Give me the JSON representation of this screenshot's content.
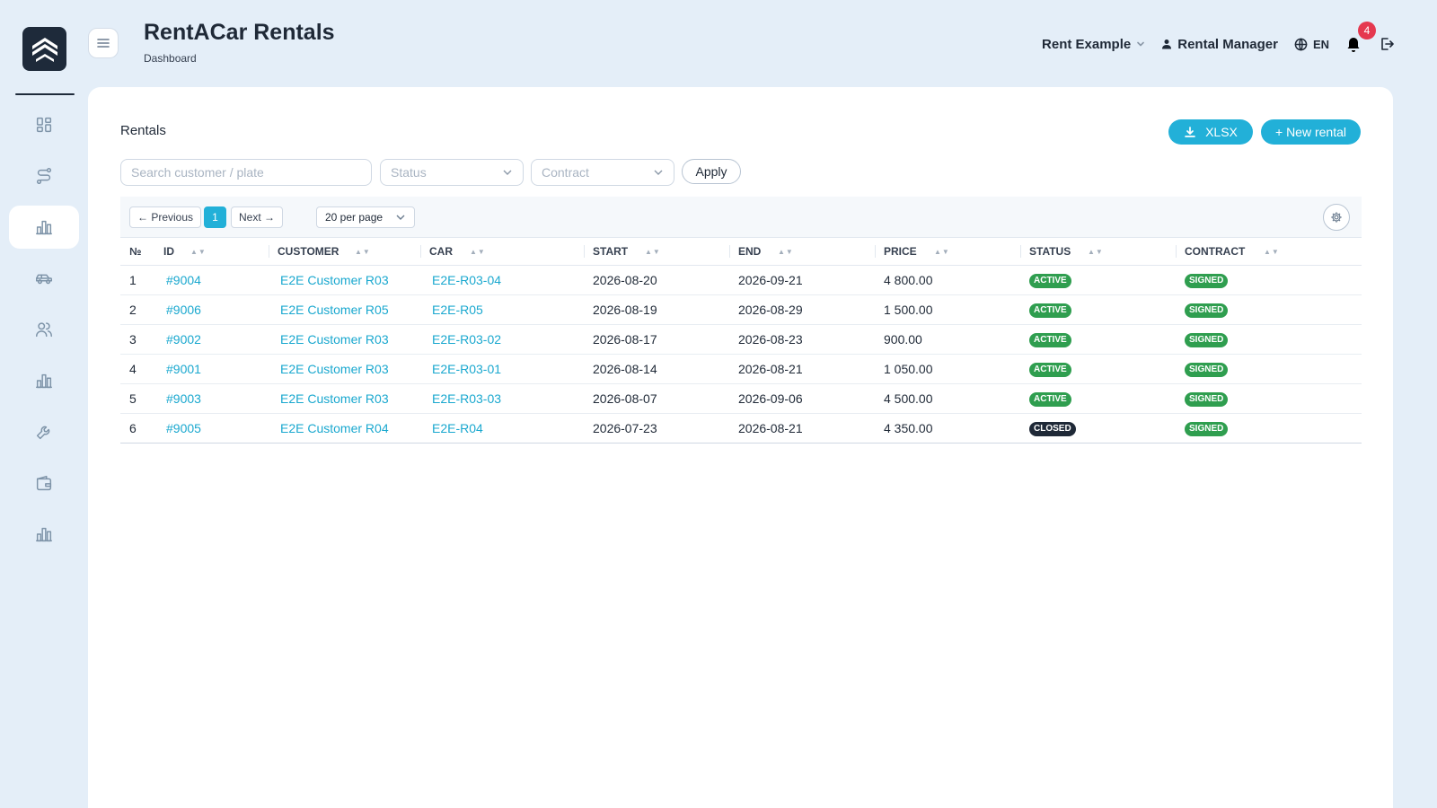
{
  "colors": {
    "accent": "#22b0d8",
    "link": "#1aa8cf",
    "active": "#2f9e4f",
    "closed": "#1f2937",
    "signed": "#2f9e4f",
    "badge": "#e5384f"
  },
  "app": {
    "title": "RentACar Rentals",
    "breadcrumb": "Dashboard"
  },
  "sidebar": {
    "items": [
      {
        "name": "dashboard-icon"
      },
      {
        "name": "routes-icon"
      },
      {
        "name": "bar-chart-icon",
        "active": true
      },
      {
        "name": "car-icon"
      },
      {
        "name": "users-icon"
      },
      {
        "name": "bar-chart-icon"
      },
      {
        "name": "wrench-icon"
      },
      {
        "name": "wallet-icon"
      },
      {
        "name": "bar-chart-icon"
      }
    ]
  },
  "topbar": {
    "company": "Rent Example",
    "user": "Rental Manager",
    "language": "EN",
    "notifications": "4"
  },
  "rentals": {
    "title": "Rentals",
    "export_label": "XLSX",
    "new_label": "+ New rental",
    "search_placeholder": "Search customer / plate",
    "status_placeholder": "Status",
    "contract_placeholder": "Contract",
    "apply_label": "Apply",
    "pagination": {
      "prev": "← Previous",
      "current": "1",
      "next": "Next →",
      "per_page": "20 per page"
    },
    "columns": [
      "№",
      "ID",
      "CUSTOMER",
      "CAR",
      "START",
      "END",
      "PRICE",
      "STATUS",
      "CONTRACT"
    ],
    "rows": [
      {
        "n": "1",
        "id": "#9004",
        "customer": "E2E Customer R03",
        "car": "E2E-R03-04",
        "start": "2026-08-20",
        "end": "2026-09-21",
        "price": "4 800.00",
        "status": "ACTIVE",
        "contract": "SIGNED"
      },
      {
        "n": "2",
        "id": "#9006",
        "customer": "E2E Customer R05",
        "car": "E2E-R05",
        "start": "2026-08-19",
        "end": "2026-08-29",
        "price": "1 500.00",
        "status": "ACTIVE",
        "contract": "SIGNED"
      },
      {
        "n": "3",
        "id": "#9002",
        "customer": "E2E Customer R03",
        "car": "E2E-R03-02",
        "start": "2026-08-17",
        "end": "2026-08-23",
        "price": "900.00",
        "status": "ACTIVE",
        "contract": "SIGNED"
      },
      {
        "n": "4",
        "id": "#9001",
        "customer": "E2E Customer R03",
        "car": "E2E-R03-01",
        "start": "2026-08-14",
        "end": "2026-08-21",
        "price": "1 050.00",
        "status": "ACTIVE",
        "contract": "SIGNED"
      },
      {
        "n": "5",
        "id": "#9003",
        "customer": "E2E Customer R03",
        "car": "E2E-R03-03",
        "start": "2026-08-07",
        "end": "2026-09-06",
        "price": "4 500.00",
        "status": "ACTIVE",
        "contract": "SIGNED"
      },
      {
        "n": "6",
        "id": "#9005",
        "customer": "E2E Customer R04",
        "car": "E2E-R04",
        "start": "2026-07-23",
        "end": "2026-08-21",
        "price": "4 350.00",
        "status": "CLOSED",
        "contract": "SIGNED"
      }
    ]
  }
}
